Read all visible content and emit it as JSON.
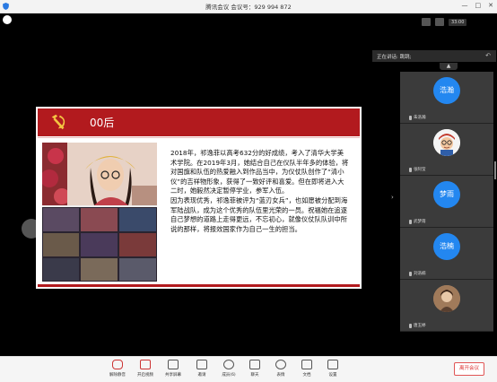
{
  "titlebar": {
    "title": "腾讯会议  会议号：929 994 872",
    "minimize": "—",
    "maximize": "□",
    "close": "✕"
  },
  "topright": {
    "time": "33:00"
  },
  "speaker": {
    "label": "正在讲话: 跳跳;"
  },
  "participants": [
    {
      "avatar_text": "浩瀚",
      "name": "朱浩瀚"
    },
    {
      "avatar_text": "",
      "name": "张阿莹"
    },
    {
      "avatar_text": "梦雨",
      "name": "武梦雨"
    },
    {
      "avatar_text": "浩楠",
      "name": "刘浩楠"
    },
    {
      "avatar_text": "",
      "name": "唐玉婷"
    }
  ],
  "slide": {
    "title": "00后",
    "paragraph1": "2018年，祁逸菲以高考632分的好成绩，考入了清华大学美术学院。在2019年3月，她结合自己在仪队半年多的体验，将对国旗和队伍的热爱融入到作品当中，为仪仗队创作了“清小仪”的吉祥物形象，获得了一致好评和喜爱。但在即将进入大二时，她毅然决定暂停学业，参军入伍。",
    "paragraph2": "因为表现优秀，祁逸菲被评为“蓝刃女兵”，也如愿被分配到海军陆战队，成为这个优秀的队伍里光荣的一员。祝福她在追逐自己梦想的道路上走得更远，不忘初心，就像仪仗队队训中所说的那样，将报效国家作为自己一生的担当。"
  },
  "toolbar": {
    "items": [
      {
        "label": "解除静音",
        "icon": "mic-icon"
      },
      {
        "label": "开启视频",
        "icon": "camera-icon"
      },
      {
        "label": "共享屏幕",
        "icon": "screen-share-icon"
      },
      {
        "label": "邀请",
        "icon": "invite-icon"
      },
      {
        "label": "成员(6)",
        "icon": "members-icon"
      },
      {
        "label": "聊天",
        "icon": "chat-icon"
      },
      {
        "label": "表情",
        "icon": "emoji-icon"
      },
      {
        "label": "文档",
        "icon": "document-icon"
      },
      {
        "label": "设置",
        "icon": "settings-icon"
      }
    ],
    "leave": "离开会议"
  }
}
